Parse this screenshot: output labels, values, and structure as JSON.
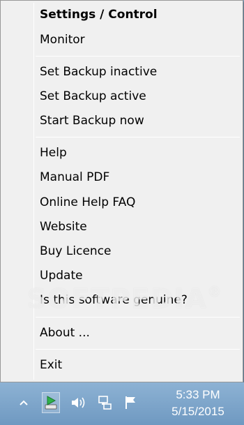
{
  "menu": {
    "items": [
      {
        "label": "Settings / Control",
        "bold": true
      },
      {
        "label": "Monitor"
      },
      {
        "label": "Set Backup inactive"
      },
      {
        "label": "Set Backup active"
      },
      {
        "label": "Start Backup now"
      },
      {
        "label": "Help"
      },
      {
        "label": "Manual PDF"
      },
      {
        "label": "Online Help FAQ"
      },
      {
        "label": "Website"
      },
      {
        "label": "Buy Licence"
      },
      {
        "label": "Update"
      },
      {
        "label": "Is this software genuine?"
      },
      {
        "label": "About ..."
      },
      {
        "label": "Exit"
      }
    ]
  },
  "watermark": {
    "text": "SOFTPEDIA",
    "mark": "®"
  },
  "taskbar": {
    "tray_icons": [
      "show-hidden-icons-icon",
      "backup-app-tray-icon",
      "volume-icon",
      "network-icon",
      "action-center-flag-icon"
    ],
    "clock": {
      "time": "5:33 PM",
      "date": "5/15/2015"
    }
  },
  "colors": {
    "menu_bg": "#f0f0f0",
    "taskbar_bg": "#7fa6c8",
    "tray_app_green": "#2fb24a"
  }
}
